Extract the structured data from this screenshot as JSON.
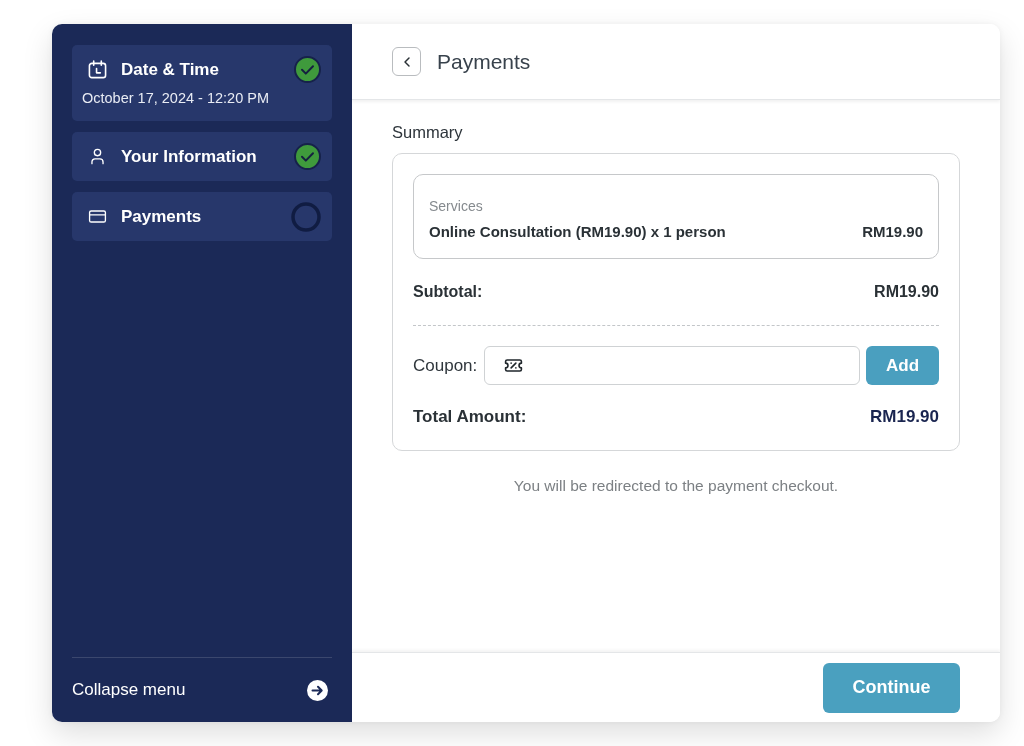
{
  "sidebar": {
    "steps": [
      {
        "label": "Date & Time",
        "detail": "October 17, 2024 - 12:20 PM",
        "completed": true
      },
      {
        "label": "Your Information",
        "completed": true
      },
      {
        "label": "Payments",
        "completed": false
      }
    ],
    "collapse_label": "Collapse menu"
  },
  "header": {
    "title": "Payments"
  },
  "summary": {
    "title": "Summary",
    "services": {
      "label": "Services",
      "items": [
        {
          "name": "Online Consultation (RM19.90) x 1 person",
          "price": "RM19.90"
        }
      ]
    },
    "subtotal": {
      "label": "Subtotal:",
      "value": "RM19.90"
    },
    "coupon": {
      "label": "Coupon:",
      "button": "Add"
    },
    "total": {
      "label": "Total Amount:",
      "value": "RM19.90"
    }
  },
  "note": "You will be redirected to the payment checkout.",
  "footer": {
    "button": "Continue"
  }
}
